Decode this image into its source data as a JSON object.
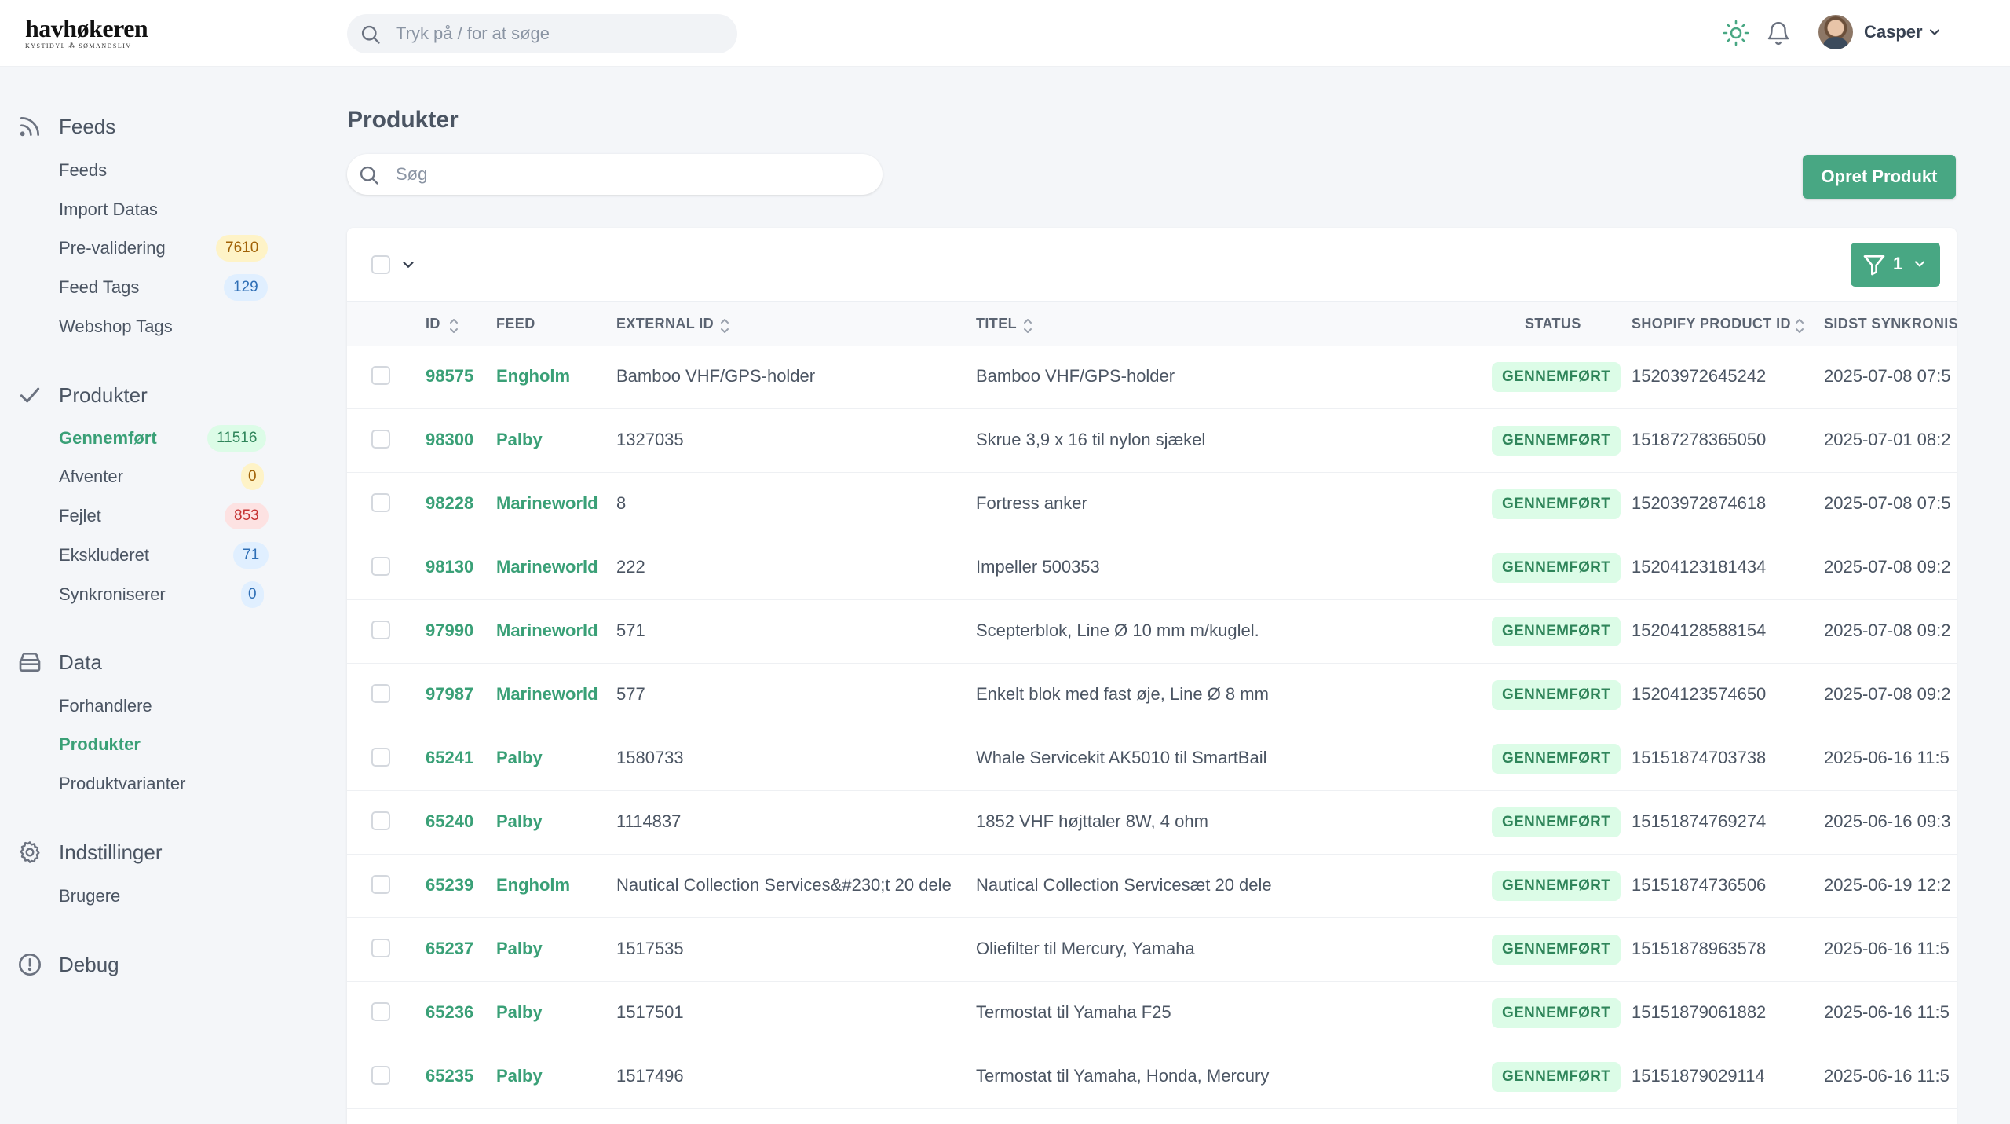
{
  "header": {
    "logo_main": "havhøkeren",
    "logo_sub": "KYSTIDYL ⁂ SØMANDSLIV",
    "search_placeholder": "Tryk på / for at søge",
    "user_name": "Casper",
    "icons": [
      "sun-icon",
      "bell-icon",
      "chevron-down-icon"
    ]
  },
  "sidebar": {
    "sections": [
      {
        "title": "Feeds",
        "icon": "rss-icon",
        "items": [
          {
            "label": "Feeds"
          },
          {
            "label": "Import Datas"
          },
          {
            "label": "Pre-validering",
            "badge": "7610",
            "badge_color": "yellow"
          },
          {
            "label": "Feed Tags",
            "badge": "129",
            "badge_color": "blue"
          },
          {
            "label": "Webshop Tags"
          }
        ]
      },
      {
        "title": "Produkter",
        "icon": "check-icon",
        "items": [
          {
            "label": "Gennemført",
            "badge": "11516",
            "badge_color": "green",
            "active": true
          },
          {
            "label": "Afventer",
            "badge": "0",
            "badge_color": "yellow"
          },
          {
            "label": "Fejlet",
            "badge": "853",
            "badge_color": "red"
          },
          {
            "label": "Ekskluderet",
            "badge": "71",
            "badge_color": "blue"
          },
          {
            "label": "Synkroniserer",
            "badge": "0",
            "badge_color": "blue"
          }
        ]
      },
      {
        "title": "Data",
        "icon": "archive-icon",
        "items": [
          {
            "label": "Forhandlere"
          },
          {
            "label": "Produkter",
            "active": true
          },
          {
            "label": "Produktvarianter"
          }
        ]
      },
      {
        "title": "Indstillinger",
        "icon": "gear-icon",
        "items": [
          {
            "label": "Brugere"
          }
        ]
      },
      {
        "title": "Debug",
        "icon": "alert-circle-icon",
        "items": []
      }
    ]
  },
  "main": {
    "title": "Produkter",
    "search_placeholder": "Søg",
    "create_button": "Opret Produkt",
    "filter_count": "1",
    "columns": [
      "ID",
      "FEED",
      "EXTERNAL ID",
      "TITEL",
      "STATUS",
      "SHOPIFY PRODUCT ID",
      "SIDST SYNKRONISERET"
    ],
    "rows": [
      {
        "id": "98575",
        "feed": "Engholm",
        "external_id": "Bamboo VHF/GPS-holder",
        "title": "Bamboo VHF/GPS-holder",
        "status": "GENNEMFØRT",
        "shopify_id": "15203972645242",
        "synced": "2025-07-08 07:5"
      },
      {
        "id": "98300",
        "feed": "Palby",
        "external_id": "1327035",
        "title": "Skrue 3,9 x 16 til nylon sjækel",
        "status": "GENNEMFØRT",
        "shopify_id": "15187278365050",
        "synced": "2025-07-01 08:2"
      },
      {
        "id": "98228",
        "feed": "Marineworld",
        "external_id": "8",
        "title": "Fortress anker",
        "status": "GENNEMFØRT",
        "shopify_id": "15203972874618",
        "synced": "2025-07-08 07:5"
      },
      {
        "id": "98130",
        "feed": "Marineworld",
        "external_id": "222",
        "title": "Impeller 500353",
        "status": "GENNEMFØRT",
        "shopify_id": "15204123181434",
        "synced": "2025-07-08 09:2"
      },
      {
        "id": "97990",
        "feed": "Marineworld",
        "external_id": "571",
        "title": "Scepterblok, Line Ø 10 mm m/kuglel.",
        "status": "GENNEMFØRT",
        "shopify_id": "15204128588154",
        "synced": "2025-07-08 09:2"
      },
      {
        "id": "97987",
        "feed": "Marineworld",
        "external_id": "577",
        "title": "Enkelt blok med fast øje, Line Ø 8 mm",
        "status": "GENNEMFØRT",
        "shopify_id": "15204123574650",
        "synced": "2025-07-08 09:2"
      },
      {
        "id": "65241",
        "feed": "Palby",
        "external_id": "1580733",
        "title": "Whale Servicekit AK5010 til SmartBail",
        "status": "GENNEMFØRT",
        "shopify_id": "15151874703738",
        "synced": "2025-06-16 11:5"
      },
      {
        "id": "65240",
        "feed": "Palby",
        "external_id": "1114837",
        "title": "1852 VHF højttaler 8W, 4 ohm",
        "status": "GENNEMFØRT",
        "shopify_id": "15151874769274",
        "synced": "2025-06-16 09:3"
      },
      {
        "id": "65239",
        "feed": "Engholm",
        "external_id": "Nautical Collection Services&#230;t 20 dele",
        "title": "Nautical Collection Servicesæt 20 dele",
        "status": "GENNEMFØRT",
        "shopify_id": "15151874736506",
        "synced": "2025-06-19 12:2"
      },
      {
        "id": "65237",
        "feed": "Palby",
        "external_id": "1517535",
        "title": "Oliefilter til Mercury, Yamaha",
        "status": "GENNEMFØRT",
        "shopify_id": "15151878963578",
        "synced": "2025-06-16 11:5"
      },
      {
        "id": "65236",
        "feed": "Palby",
        "external_id": "1517501",
        "title": "Termostat til Yamaha F25",
        "status": "GENNEMFØRT",
        "shopify_id": "15151879061882",
        "synced": "2025-06-16 11:5"
      },
      {
        "id": "65235",
        "feed": "Palby",
        "external_id": "1517496",
        "title": "Termostat til Yamaha, Honda, Mercury",
        "status": "GENNEMFØRT",
        "shopify_id": "15151879029114",
        "synced": "2025-06-16 11:5"
      }
    ]
  },
  "colors": {
    "accent": "#48a783",
    "accent_text": "#3aa077",
    "status_bg": "#dcfce7",
    "status_text": "#2f855a"
  }
}
